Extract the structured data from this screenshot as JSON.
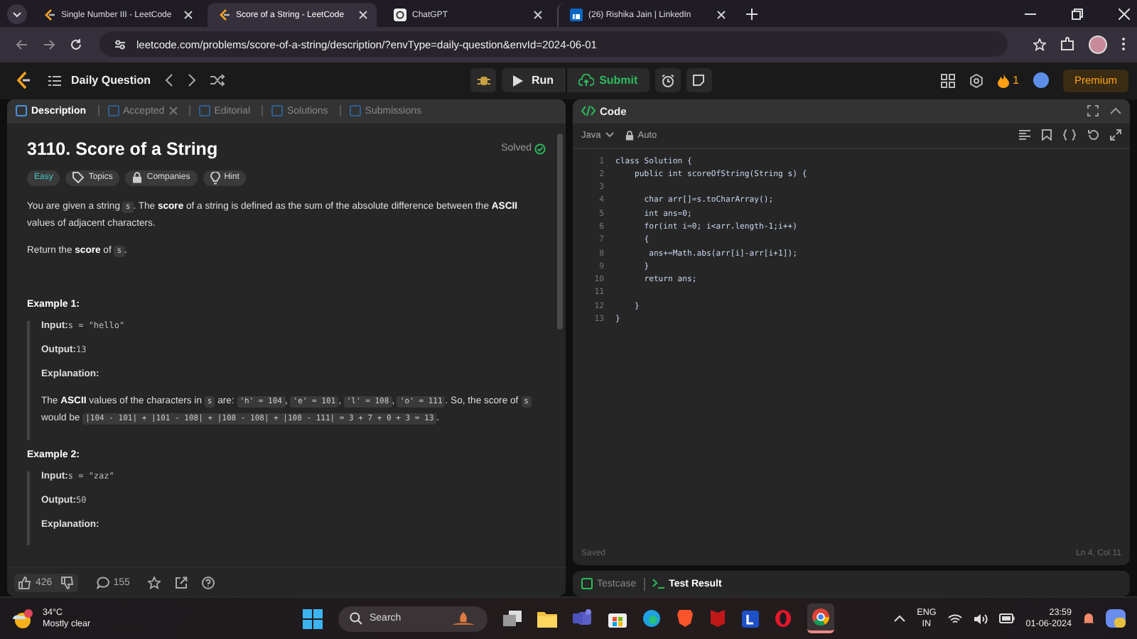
{
  "browser": {
    "tabs": [
      {
        "kind": "leetcode",
        "title": "Single Number III - LeetCode",
        "selected": false
      },
      {
        "kind": "leetcode",
        "title": "Score of a String - LeetCode",
        "selected": true
      },
      {
        "kind": "chat",
        "title": "ChatGPT",
        "selected": false
      },
      {
        "kind": "social",
        "title": "(26) Rishika Jain | LinkedIn",
        "selected": false
      }
    ],
    "url": "leetcode.com/problems/score-of-a-string/description/?envType=daily-question&envId=2024-06-01"
  },
  "nav": {
    "title": "Daily Question",
    "run": "Run",
    "submit": "Submit",
    "streak": "1",
    "premium": "Premium"
  },
  "problem": {
    "tabs": [
      {
        "label": "Description",
        "selected": true,
        "closable": false
      },
      {
        "label": "Accepted",
        "selected": false,
        "closable": true
      },
      {
        "label": "Editorial",
        "selected": false,
        "closable": false
      },
      {
        "label": "Solutions",
        "selected": false,
        "closable": false
      },
      {
        "label": "Submissions",
        "selected": false,
        "closable": false
      }
    ],
    "title": "3110. Score of a String",
    "status": "Solved",
    "tags": [
      {
        "kind": "difficulty",
        "label": "Easy"
      },
      {
        "kind": "topics",
        "label": "Topics"
      },
      {
        "kind": "companies",
        "label": "Companies"
      },
      {
        "kind": "hint",
        "label": "Hint"
      }
    ],
    "paragraphs": [
      [
        {
          "kind": "text",
          "text": "You are given a string "
        },
        {
          "kind": "code",
          "text": "s"
        },
        {
          "kind": "text",
          "text": ". The **score** of a string is defined as the sum of the absolute difference between the **ASCII** values of adjacent characters."
        }
      ],
      [
        {
          "kind": "text",
          "text": "Return the **score** of "
        },
        {
          "kind": "code",
          "text": "s"
        },
        {
          "kind": "text",
          "text": "."
        }
      ]
    ],
    "examples": [
      {
        "title": "Example 1:",
        "items": [
          {
            "label": "Input:",
            "value": "s = \"hello\""
          },
          {
            "label": "Output:",
            "value": "13"
          },
          {
            "label": "Explanation:"
          }
        ],
        "explanation": [
          {
            "kind": "text",
            "text": "The **ASCII** values of the characters in "
          },
          {
            "kind": "code",
            "text": "s"
          },
          {
            "kind": "text",
            "text": " are: "
          },
          {
            "kind": "code",
            "text": "'h' = 104"
          },
          {
            "kind": "text",
            "text": ", "
          },
          {
            "kind": "code",
            "text": "'e' = 101"
          },
          {
            "kind": "text",
            "text": ", "
          },
          {
            "kind": "code",
            "text": "'l' = 108"
          },
          {
            "kind": "text",
            "text": ", "
          },
          {
            "kind": "code",
            "text": "'o' = 111"
          },
          {
            "kind": "text",
            "text": ". So, the score of "
          },
          {
            "kind": "code",
            "text": "s"
          },
          {
            "kind": "text",
            "text": " would be "
          },
          {
            "kind": "code",
            "text": "|104 - 101| + |101 - 108| + |108 - 108| + |108 - 111| = 3 + 7 + 0 + 3 = 13"
          },
          {
            "kind": "text",
            "text": "."
          }
        ]
      },
      {
        "title": "Example 2:",
        "items": [
          {
            "label": "Input:",
            "value": "s = \"zaz\""
          },
          {
            "label": "Output:",
            "value": "50"
          },
          {
            "label": "Explanation:"
          }
        ]
      }
    ],
    "likes": "426",
    "comments": "155"
  },
  "editor": {
    "title": "Code",
    "language": "Java",
    "mode": "Auto",
    "lines": [
      {
        "number": "1",
        "text": "class Solution {"
      },
      {
        "number": "2",
        "text": "    public int scoreOfString(String s) {"
      },
      {
        "number": "3"
      },
      {
        "number": "4",
        "text": "      char arr[]=s.toCharArray();"
      },
      {
        "number": "5",
        "text": "      int ans=0;"
      },
      {
        "number": "6",
        "text": "      for(int i=0; i<arr.length-1;i++)"
      },
      {
        "number": "7",
        "text": "      {"
      },
      {
        "number": "8",
        "text": "       ans+=Math.abs(arr[i]-arr[i+1]);"
      },
      {
        "number": "9",
        "text": "      }"
      },
      {
        "number": "10",
        "text": "      return ans;"
      },
      {
        "number": "11"
      },
      {
        "number": "12",
        "text": "    }"
      },
      {
        "number": "13",
        "text": "}"
      }
    ],
    "status": "Saved",
    "cursor": "Ln 4, Col 11"
  },
  "console": {
    "tabs": [
      {
        "label": "Testcase",
        "selected": false
      },
      {
        "label": "Test Result",
        "selected": true
      }
    ]
  },
  "taskbar": {
    "temperature": "34°C",
    "weather": "Mostly clear",
    "search": "Search",
    "language": "ENG",
    "region": "IN",
    "time": "23:59",
    "date": "01-06-2024"
  }
}
